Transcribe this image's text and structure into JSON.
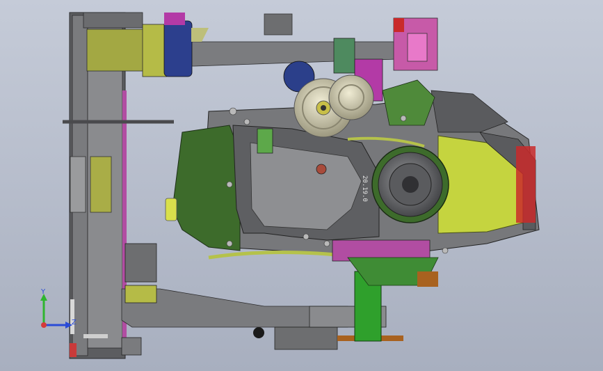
{
  "viewport": {
    "background_top": "#c5cbd8",
    "background_bottom": "#a8afbf"
  },
  "model": {
    "part_colors": {
      "frame_gray": "#6d6e70",
      "frame_dark": "#4d4e52",
      "olive": "#a9ad47",
      "yellow_green": "#c5d43f",
      "engine_green": "#3d6b2b",
      "engine_gray": "#77787b",
      "pulley_light": "#d7d3b8",
      "magenta": "#b33aa6",
      "pink": "#d55ab5",
      "navy": "#2b3f8a",
      "red": "#c92a2a",
      "bright_green": "#2fa02c",
      "orange_brown": "#a8621f"
    },
    "engraved_text": [
      "20.19.0"
    ]
  },
  "triad": {
    "y_label": "Y",
    "z_label": "Z",
    "y_color": "#2fb52f",
    "z_color": "#2a4bd7",
    "origin_color": "#d43a3a",
    "label_color": "#2a4bd7"
  }
}
